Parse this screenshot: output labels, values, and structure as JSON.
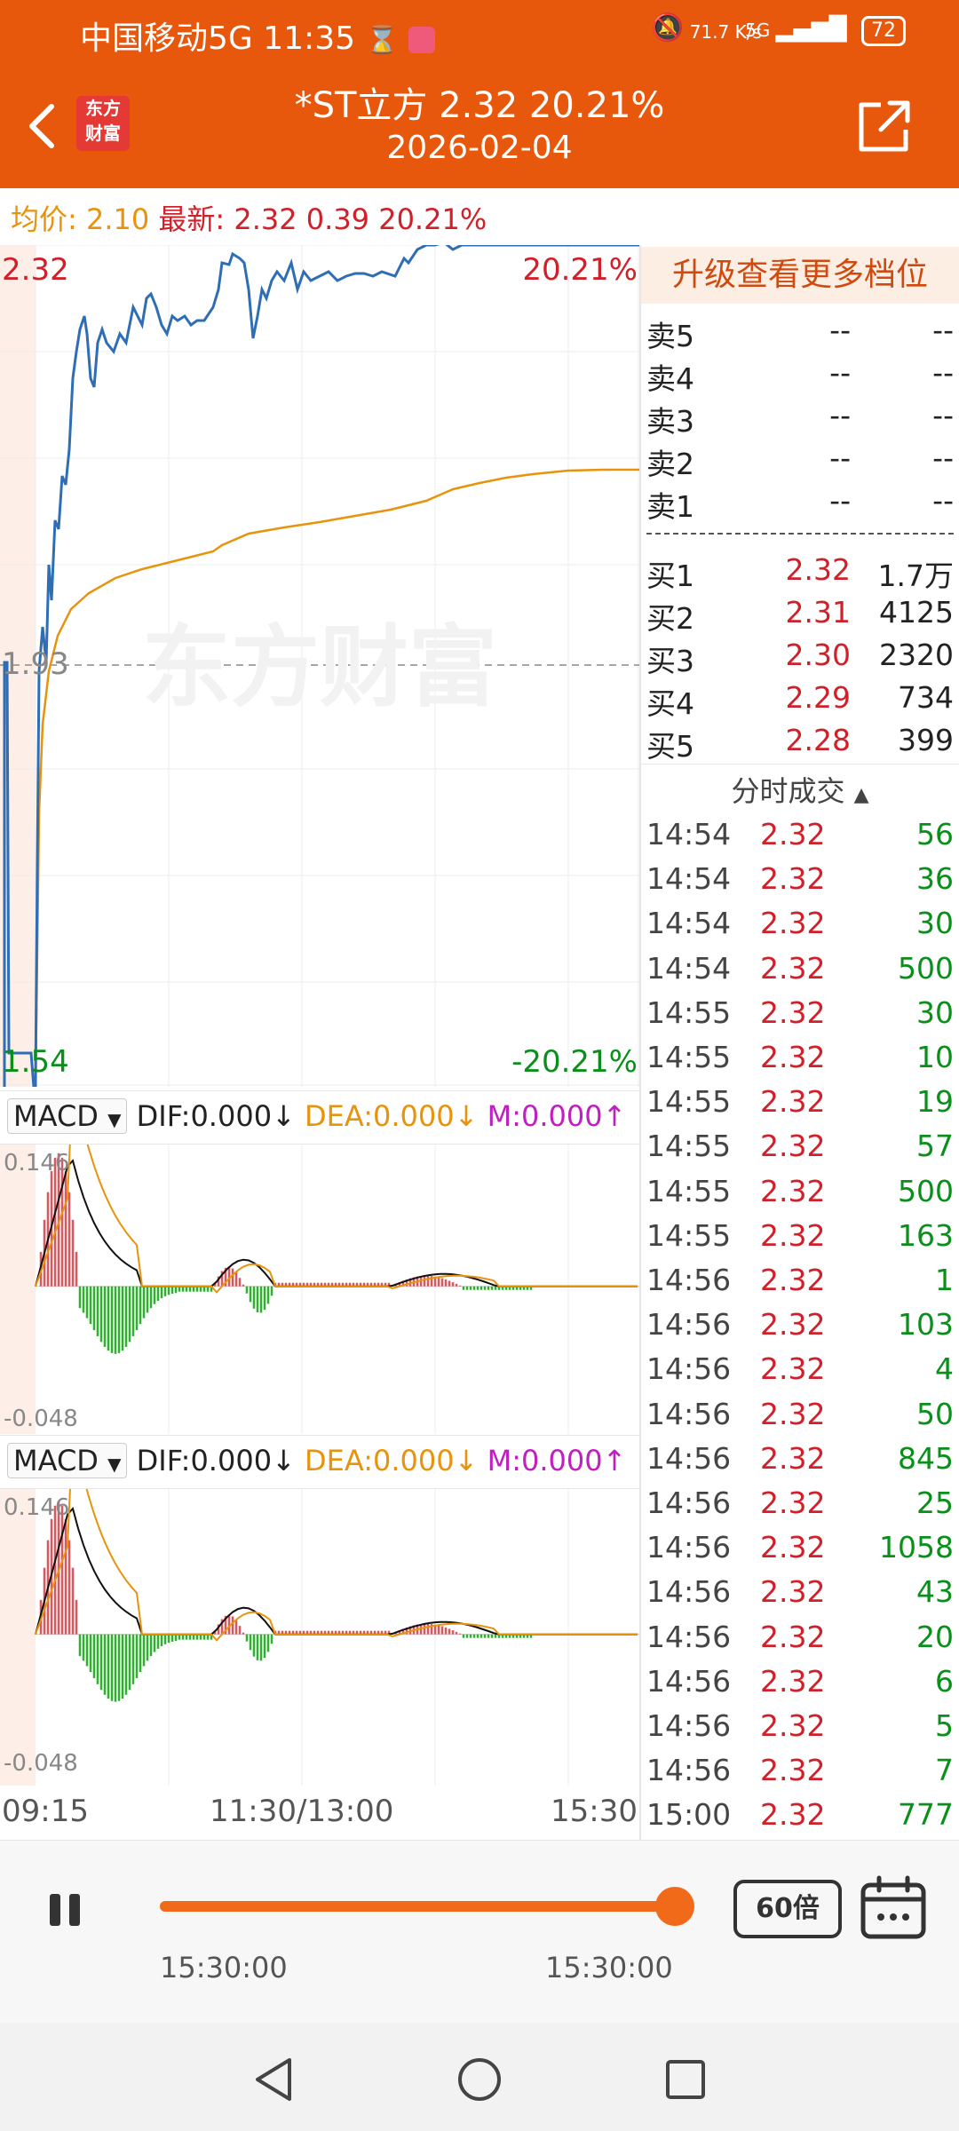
{
  "status_bar": {
    "carrier": "中国移动5G",
    "time": "11:35",
    "net_speed": "71.7 K/s",
    "signal": "5G",
    "battery": "72"
  },
  "header": {
    "logo_text": "东方财富",
    "title": "*ST立方  2.32  20.21%",
    "date": "2026-02-04",
    "back_icon": "back-arrow-icon",
    "share_icon": "external-link-icon"
  },
  "info_line": {
    "avg_label": "均价:",
    "avg_value": "2.10",
    "latest_label": "最新:",
    "latest_value": "2.32",
    "change": "0.39",
    "change_pct": "20.21%"
  },
  "chart_labels": {
    "price_high": "2.32",
    "pct_high": "20.21%",
    "price_mid": "1.93",
    "price_low": "1.54",
    "pct_low": "-20.21%",
    "watermark": "东方财富"
  },
  "macd_panels": [
    {
      "selector": "MACD",
      "dif": "DIF:0.000",
      "dif_arrow": "↓",
      "dea": "DEA:0.000",
      "dea_arrow": "↓",
      "m": "M:0.000",
      "m_arrow": "↑",
      "ymax": "0.146",
      "ymin": "-0.048"
    },
    {
      "selector": "MACD",
      "dif": "DIF:0.000",
      "dif_arrow": "↓",
      "dea": "DEA:0.000",
      "dea_arrow": "↓",
      "m": "M:0.000",
      "m_arrow": "↑",
      "ymax": "0.146",
      "ymin": "-0.048"
    }
  ],
  "time_axis": [
    "09:15",
    "11:30/13:00",
    "15:30"
  ],
  "order_book": {
    "upgrade_label": "升级查看更多档位",
    "asks": [
      {
        "label": "卖5",
        "price": "--",
        "vol": "--"
      },
      {
        "label": "卖4",
        "price": "--",
        "vol": "--"
      },
      {
        "label": "卖3",
        "price": "--",
        "vol": "--"
      },
      {
        "label": "卖2",
        "price": "--",
        "vol": "--"
      },
      {
        "label": "卖1",
        "price": "--",
        "vol": "--"
      }
    ],
    "bids": [
      {
        "label": "买1",
        "price": "2.32",
        "vol": "1.7万"
      },
      {
        "label": "买2",
        "price": "2.31",
        "vol": "4125"
      },
      {
        "label": "买3",
        "price": "2.30",
        "vol": "2320"
      },
      {
        "label": "买4",
        "price": "2.29",
        "vol": "734"
      },
      {
        "label": "买5",
        "price": "2.28",
        "vol": "399"
      }
    ]
  },
  "trades": {
    "header": "分时成交",
    "rows": [
      {
        "time": "14:54",
        "price": "2.32",
        "vol": "56"
      },
      {
        "time": "14:54",
        "price": "2.32",
        "vol": "36"
      },
      {
        "time": "14:54",
        "price": "2.32",
        "vol": "30"
      },
      {
        "time": "14:54",
        "price": "2.32",
        "vol": "500"
      },
      {
        "time": "14:55",
        "price": "2.32",
        "vol": "30"
      },
      {
        "time": "14:55",
        "price": "2.32",
        "vol": "10"
      },
      {
        "time": "14:55",
        "price": "2.32",
        "vol": "19"
      },
      {
        "time": "14:55",
        "price": "2.32",
        "vol": "57"
      },
      {
        "time": "14:55",
        "price": "2.32",
        "vol": "500"
      },
      {
        "time": "14:55",
        "price": "2.32",
        "vol": "163"
      },
      {
        "time": "14:56",
        "price": "2.32",
        "vol": "1"
      },
      {
        "time": "14:56",
        "price": "2.32",
        "vol": "103"
      },
      {
        "time": "14:56",
        "price": "2.32",
        "vol": "4"
      },
      {
        "time": "14:56",
        "price": "2.32",
        "vol": "50"
      },
      {
        "time": "14:56",
        "price": "2.32",
        "vol": "845"
      },
      {
        "time": "14:56",
        "price": "2.32",
        "vol": "25"
      },
      {
        "time": "14:56",
        "price": "2.32",
        "vol": "1058"
      },
      {
        "time": "14:56",
        "price": "2.32",
        "vol": "43"
      },
      {
        "time": "14:56",
        "price": "2.32",
        "vol": "20"
      },
      {
        "time": "14:56",
        "price": "2.32",
        "vol": "6"
      },
      {
        "time": "14:56",
        "price": "2.32",
        "vol": "5"
      },
      {
        "time": "14:56",
        "price": "2.32",
        "vol": "7"
      },
      {
        "time": "15:00",
        "price": "2.32",
        "vol": "777"
      }
    ]
  },
  "playback": {
    "speed_label": "60倍",
    "start_time": "15:30:00",
    "end_time": "15:30:00",
    "progress": 1.0
  },
  "colors": {
    "brand": "#e8580c",
    "up": "#d0202a",
    "down": "#0a8f1a",
    "avg_line": "#e8930c",
    "price_line": "#2f6db5"
  }
}
